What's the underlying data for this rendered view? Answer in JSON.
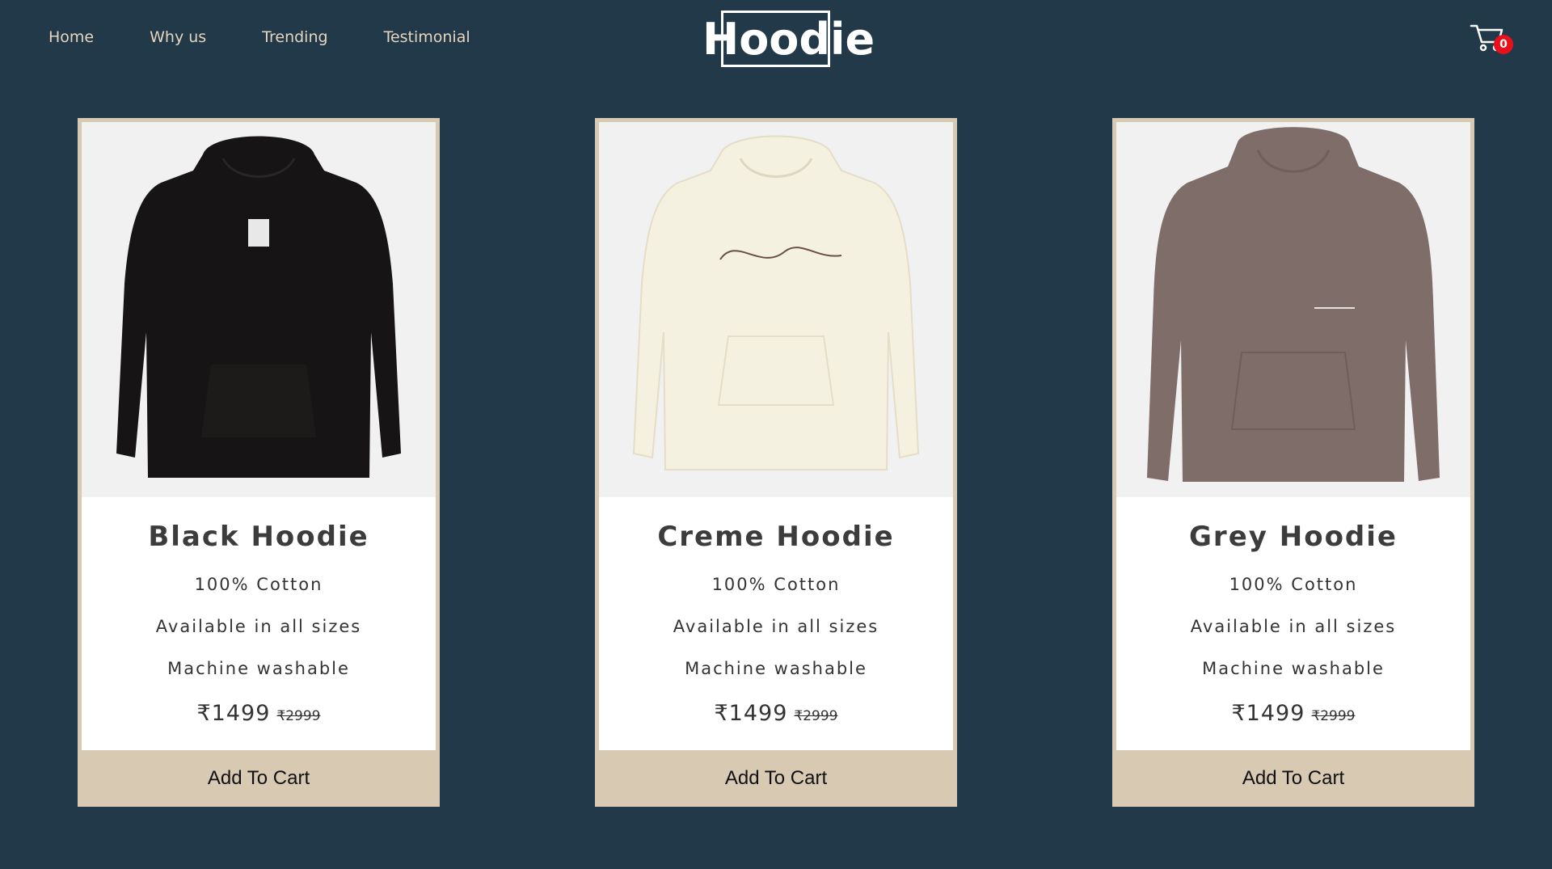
{
  "nav": {
    "links": [
      "Home",
      "Why us",
      "Trending",
      "Testimonial"
    ],
    "logo": "Hoodie",
    "cart_count": "0"
  },
  "products": [
    {
      "name": "Black Hoodie",
      "features": [
        "100% Cotton",
        "Available in all sizes",
        "Machine washable"
      ],
      "price": "₹1499",
      "old_price": "₹2999",
      "button": "Add To Cart",
      "color": "#161414"
    },
    {
      "name": "Creme Hoodie",
      "features": [
        "100% Cotton",
        "Available in all sizes",
        "Machine washable"
      ],
      "price": "₹1499",
      "old_price": "₹2999",
      "button": "Add To Cart",
      "color": "#f5f1e0"
    },
    {
      "name": "Grey Hoodie",
      "features": [
        "100% Cotton",
        "Available in all sizes",
        "Machine washable"
      ],
      "price": "₹1499",
      "old_price": "₹2999",
      "button": "Add To Cart",
      "color": "#7e6d68"
    }
  ],
  "colors": {
    "background": "#213948",
    "accent": "#d8c9b3",
    "nav_text": "#e6d6bf",
    "badge": "#e8101b"
  }
}
